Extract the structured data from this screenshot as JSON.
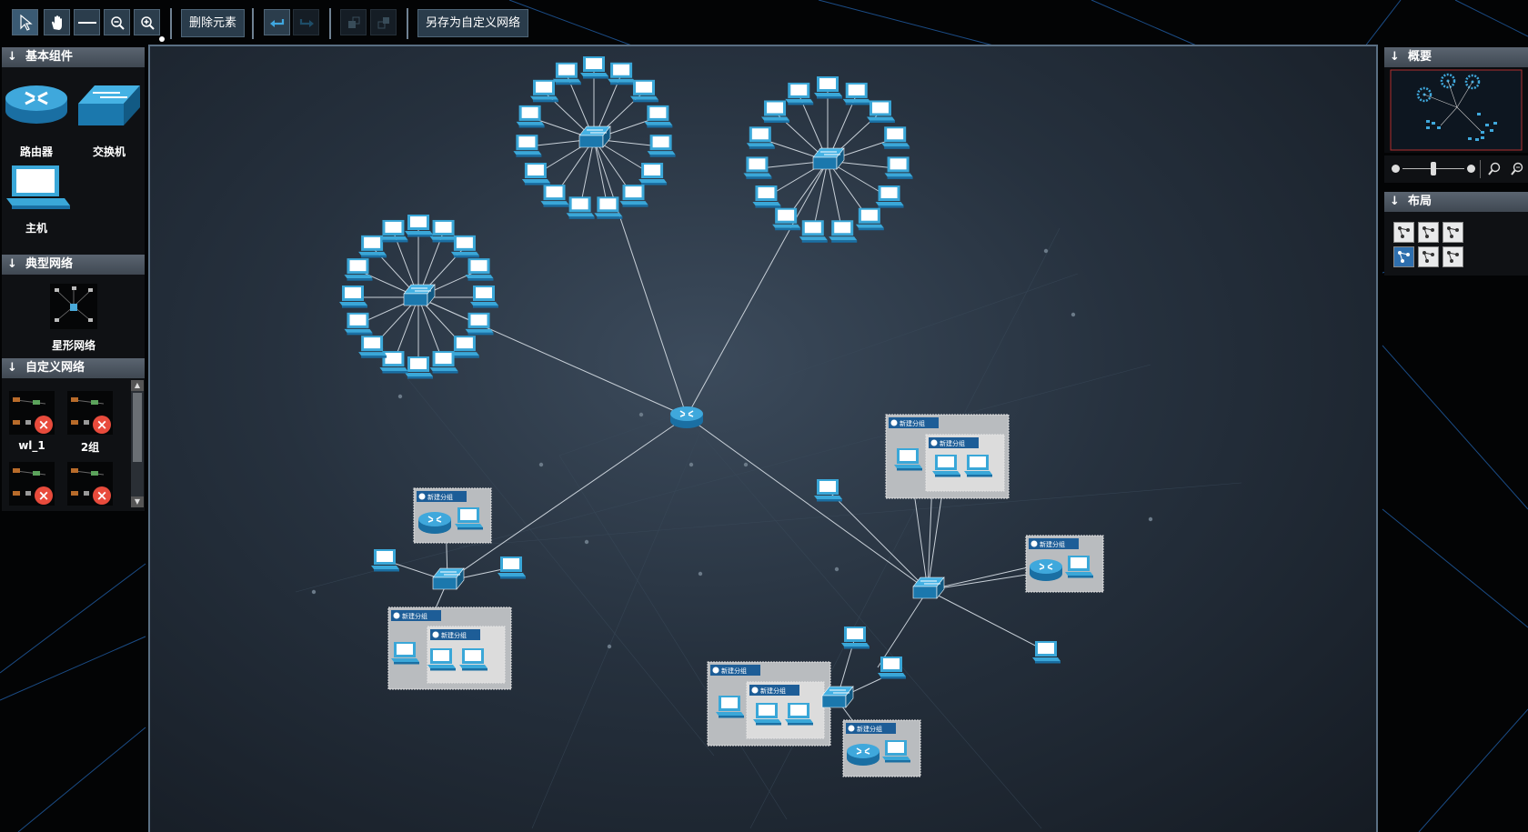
{
  "toolbar": {
    "tools": [
      "select-tool",
      "pan-tool",
      "line-tool",
      "zoom-out-tool",
      "zoom-in-tool"
    ],
    "delete_label": "删除元素",
    "undo_icon": "undo-icon",
    "redo_icon": "redo-icon",
    "group_icon": "group-icon",
    "ungroup_icon": "ungroup-icon",
    "save_custom_label": "另存为自定义网络"
  },
  "left_panel": {
    "basic_title": "基本组件",
    "basic_items": [
      {
        "label": "路由器",
        "icon": "router-icon"
      },
      {
        "label": "交换机",
        "icon": "switch-icon"
      },
      {
        "label": "主机",
        "icon": "host-icon"
      }
    ],
    "typical_title": "典型网络",
    "typical_items": [
      {
        "label": "星形网络",
        "icon": "star-network-icon"
      }
    ],
    "custom_title": "自定义网络",
    "custom_items": [
      {
        "label": "wl_1"
      },
      {
        "label": "2组"
      },
      {
        "label": ""
      },
      {
        "label": ""
      }
    ]
  },
  "right_panel": {
    "overview_title": "概要",
    "layout_title": "布局",
    "layout_buttons": [
      "layout-hierarchic-icon",
      "layout-tree-icon",
      "layout-circle-icon",
      "layout-radial-icon",
      "layout-organic-icon",
      "layout-symmetric-icon"
    ]
  },
  "canvas": {
    "group_label": "新建分组",
    "colors": {
      "device": "#3aa7d8",
      "device_dark": "#1a6fa3",
      "link": "#c8d0d8",
      "group_bg": "#b9bcbf"
    }
  }
}
